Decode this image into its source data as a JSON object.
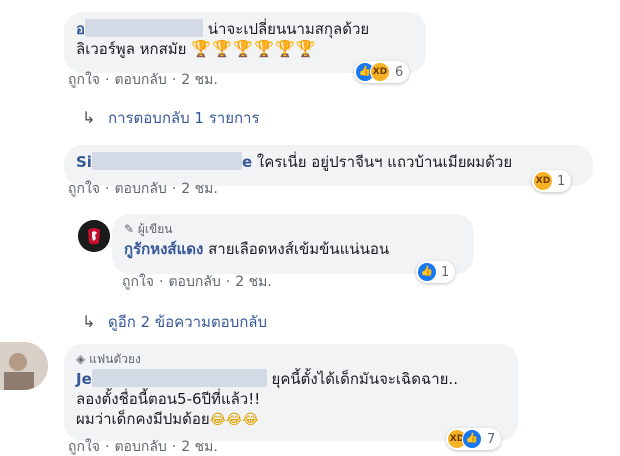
{
  "comments": [
    {
      "author_visible": "อ",
      "line1": "น่าจะเปลี่ยนนามสกุลด้วย",
      "line2_text": "ลิเวอร์พูล หกสมัย",
      "line2_emoji": "🏆🏆🏆🏆🏆🏆",
      "reaction_count": "6",
      "actions": {
        "like": "ถูกใจ",
        "reply": "ตอบกลับ",
        "time": "2 ชม."
      }
    },
    {
      "author_visible_start": "Si",
      "author_visible_end": "e",
      "text": "ใครเนี่ย อยู่ปราจีนฯ แถวบ้านเมียผมด้วย",
      "reaction_count": "1",
      "actions": {
        "like": "ถูกใจ",
        "reply": "ตอบกลับ",
        "time": "2 ชม."
      }
    },
    {
      "badge": "ผู้เขียน",
      "author": "กูรักหงส์แดง",
      "text": "สายเลือดหงส์เข้มข้นแน่นอน",
      "reaction_count": "1",
      "actions": {
        "like": "ถูกใจ",
        "reply": "ตอบกลับ",
        "time": "2 ชม."
      }
    },
    {
      "badge": "แฟนตัวยง",
      "author_visible": "Je",
      "line1": "ยุคนี้ตั้งได้เด็กมันจะเฉิดฉาย..",
      "line2": "ลองตั้งชื่อนี้ตอน5-6ปีที่แล้ว!!",
      "line3_text": "ผมว่าเด็กคงมีปมด้อย",
      "line3_emoji": "😂😂😂",
      "reaction_count": "7",
      "actions": {
        "like": "ถูกใจ",
        "reply": "ตอบกลับ",
        "time": "2 ชม."
      }
    }
  ],
  "reply_links": {
    "first": "การตอบกลับ 1 รายการ",
    "second": "ดูอีก 2 ข้อความตอบกลับ"
  },
  "icons": {
    "reply_arrow": "↳",
    "pencil": "✎",
    "diamond": "◈"
  }
}
